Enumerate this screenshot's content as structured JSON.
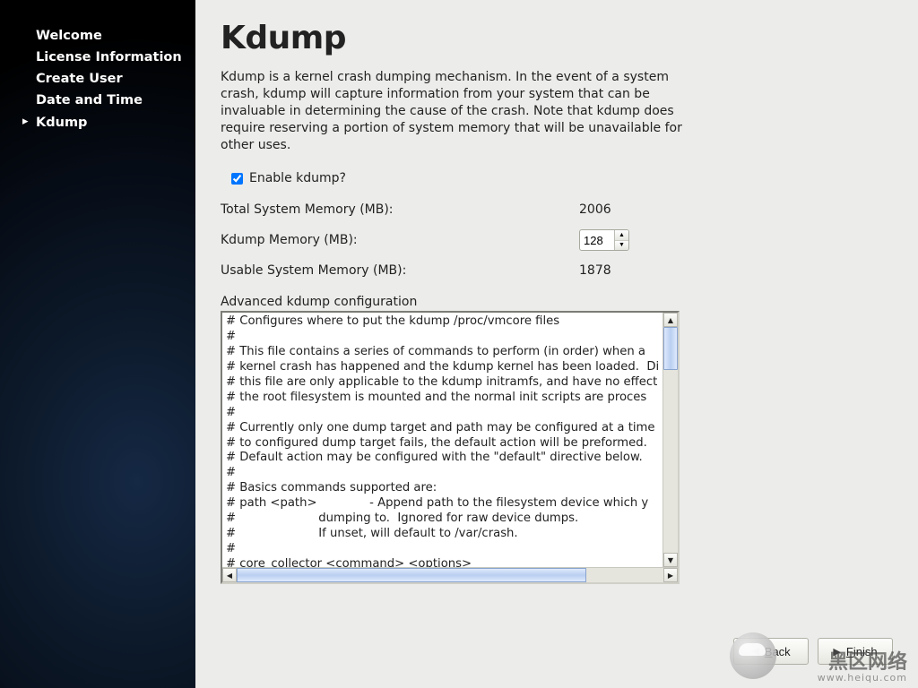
{
  "sidebar": {
    "items": [
      {
        "label": "Welcome"
      },
      {
        "label": "License Information"
      },
      {
        "label": "Create User"
      },
      {
        "label": "Date and Time"
      },
      {
        "label": "Kdump"
      }
    ],
    "active_index": 4
  },
  "page": {
    "title": "Kdump",
    "description": "Kdump is a kernel crash dumping mechanism. In the event of a system crash, kdump will capture information from your system that can be invaluable in determining the cause of the crash. Note that kdump does require reserving a portion of system memory that will be unavailable for other uses.",
    "enable_label": "Enable kdump?",
    "enable_checked": true,
    "total_label": "Total System Memory (MB):",
    "total_value": "2006",
    "kdump_label": "Kdump Memory (MB):",
    "kdump_value": "128",
    "usable_label": "Usable System Memory (MB):",
    "usable_value": "1878",
    "advanced_label": "Advanced kdump configuration",
    "config_text": "# Configures where to put the kdump /proc/vmcore files\n#\n# This file contains a series of commands to perform (in order) when a\n# kernel crash has happened and the kdump kernel has been loaded.  Di\n# this file are only applicable to the kdump initramfs, and have no effect\n# the root filesystem is mounted and the normal init scripts are proces\n#\n# Currently only one dump target and path may be configured at a time\n# to configured dump target fails, the default action will be preformed.\n# Default action may be configured with the \"default\" directive below.\n#\n# Basics commands supported are:\n# path <path>              - Append path to the filesystem device which y\n#                      dumping to.  Ignored for raw device dumps.\n#                      If unset, will default to /var/crash.\n#\n# core_collector <command> <options>"
  },
  "buttons": {
    "back": "Back",
    "finish": "Finish"
  },
  "watermark": {
    "text": "黑区网络",
    "url": "www.heiqu.com"
  }
}
